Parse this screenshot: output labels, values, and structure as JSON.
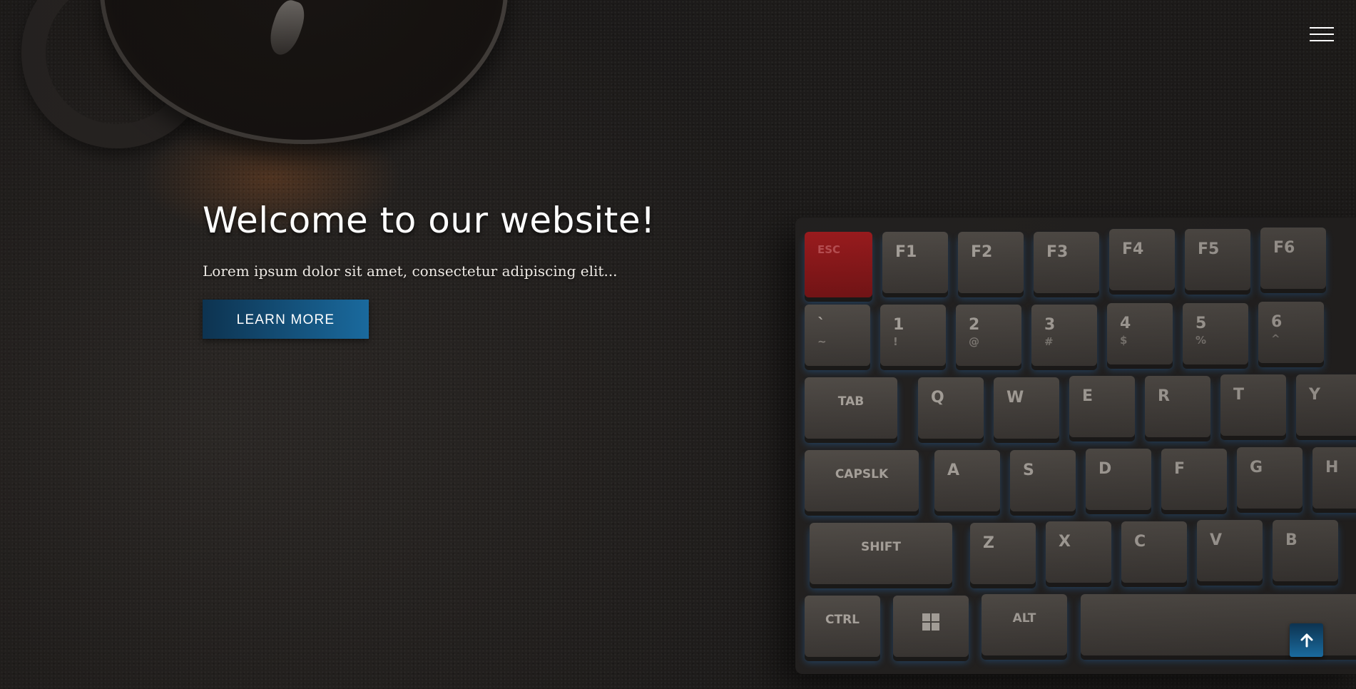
{
  "hero": {
    "headline": "Welcome to our website!",
    "subtext": "Lorem ipsum dolor sit amet, consectetur adipiscing elit...",
    "cta_label": "LEARN MORE"
  },
  "nav": {
    "menu_icon": "hamburger-menu-icon"
  },
  "back_to_top": {
    "icon": "arrow-up-icon"
  },
  "background": {
    "keyboard_keys": [
      [
        "ESC",
        "F1",
        "F2",
        "F3",
        "F4",
        "F5",
        "F6"
      ],
      [
        "`",
        "1",
        "2",
        "3",
        "4",
        "5",
        "6"
      ],
      [
        "TAB",
        "Q",
        "W",
        "E",
        "R",
        "T",
        "Y"
      ],
      [
        "CAPSLK",
        "A",
        "S",
        "D",
        "F",
        "G",
        "H"
      ],
      [
        "SHIFT",
        "Z",
        "X",
        "C",
        "V",
        "B"
      ],
      [
        "CTRL",
        "ALT"
      ]
    ],
    "number_key_symbols": [
      "~",
      "!",
      "@",
      "#",
      "$",
      "%",
      "^"
    ]
  },
  "colors": {
    "accent_dark": "#0d3350",
    "accent_light": "#1a6a9e",
    "esc_key": "#a81c1f",
    "background": "#2a2725"
  }
}
